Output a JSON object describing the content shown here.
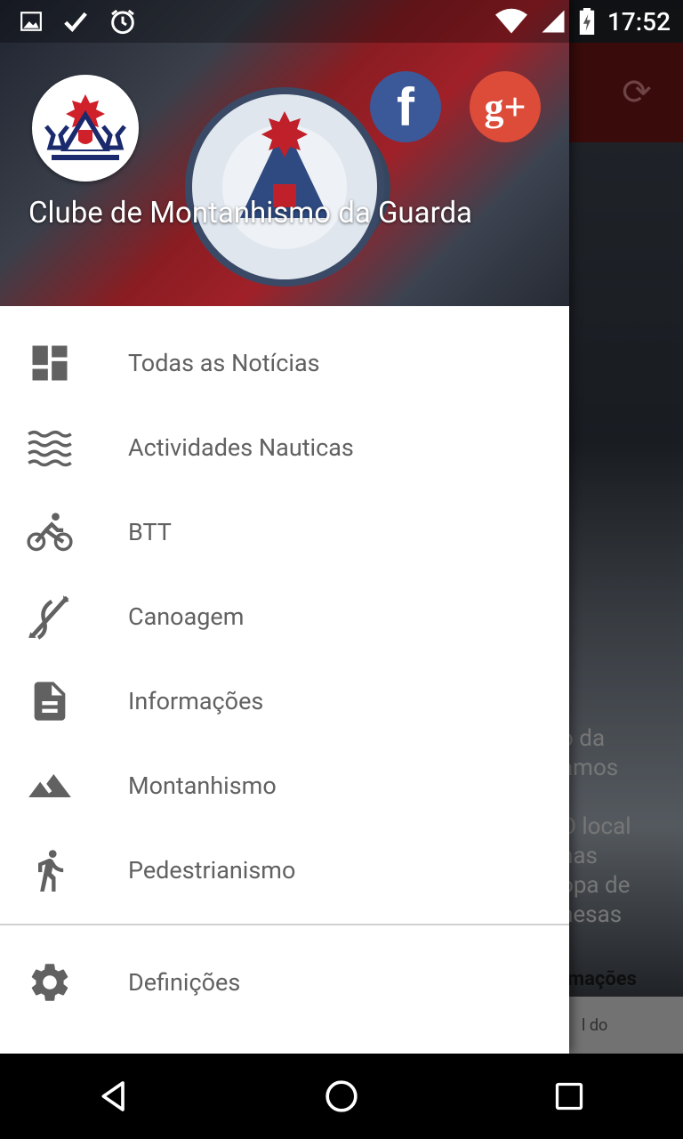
{
  "status_bar": {
    "time": "17:52",
    "left_icons": [
      "image-icon",
      "check-icon",
      "alarm-icon"
    ],
    "right_icons": [
      "wifi-icon",
      "signal-icon",
      "battery-charging-icon"
    ]
  },
  "background_screen": {
    "snippet_lines": [
      "o da",
      "amos",
      "O local",
      "nas",
      "opa de",
      "nesas",
      "rmações",
      "l do"
    ]
  },
  "drawer": {
    "header": {
      "title": "Clube de Montanhismo da Guarda",
      "social": [
        {
          "name": "facebook",
          "glyph": "f",
          "color": "#3b5998"
        },
        {
          "name": "google-plus",
          "glyph": "g+",
          "color": "#dd4b39"
        }
      ]
    },
    "menu": [
      {
        "label": "Todas as Notícias",
        "icon": "dashboard-icon"
      },
      {
        "label": "Actividades Nauticas",
        "icon": "waves-icon"
      },
      {
        "label": "BTT",
        "icon": "bike-icon"
      },
      {
        "label": "Canoagem",
        "icon": "canoe-icon"
      },
      {
        "label": "Informações",
        "icon": "document-icon"
      },
      {
        "label": "Montanhismo",
        "icon": "mountain-icon"
      },
      {
        "label": "Pedestrianismo",
        "icon": "walk-icon"
      }
    ],
    "settings": {
      "label": "Definições",
      "icon": "settings-icon"
    }
  },
  "colors": {
    "appbar": "#6a1414",
    "menu_text": "#616161",
    "facebook": "#3b5998",
    "google_plus": "#dd4b39"
  }
}
